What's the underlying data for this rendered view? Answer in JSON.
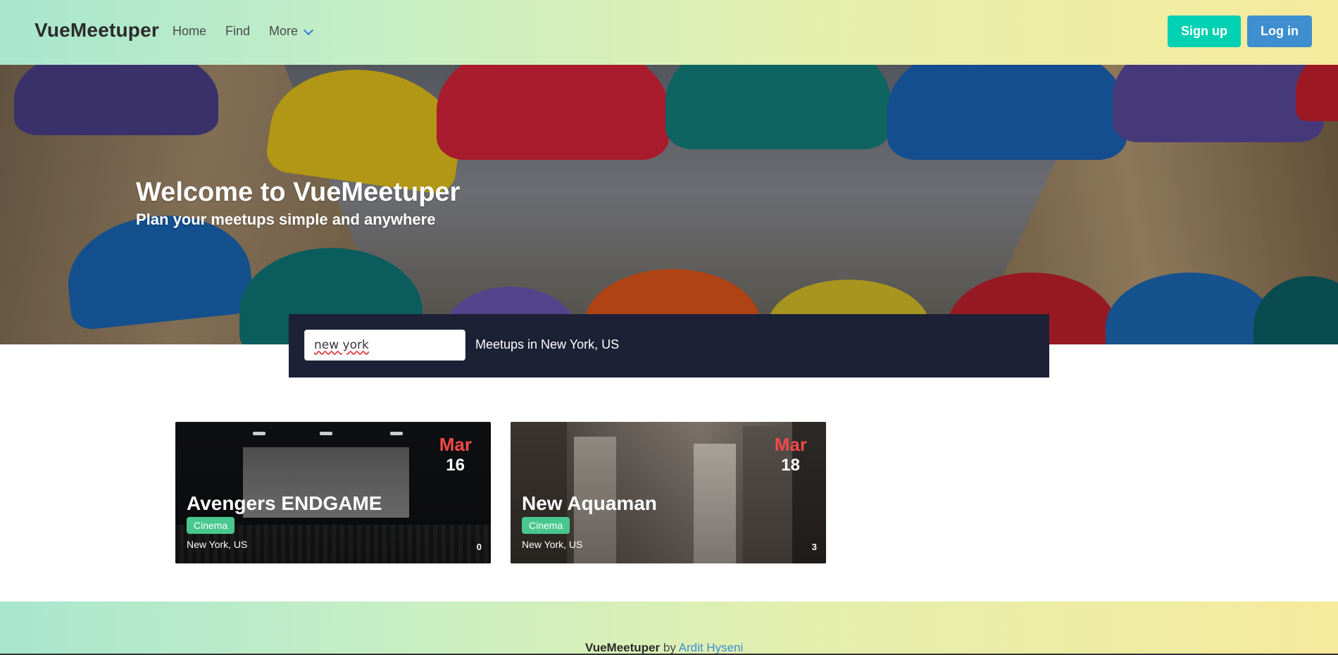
{
  "navbar": {
    "brand": "VueMeetuper",
    "items": [
      {
        "label": "Home"
      },
      {
        "label": "Find"
      },
      {
        "label": "More"
      }
    ],
    "signup_label": "Sign up",
    "login_label": "Log in"
  },
  "hero": {
    "title": "Welcome to VueMeetuper",
    "subtitle": "Plan your meetups simple and anywhere"
  },
  "search": {
    "value": "new york",
    "result_text": "Meetups in New York, US"
  },
  "meetups": [
    {
      "month": "Mar",
      "day": "16",
      "title": "Avengers ENDGAME",
      "category": "Cinema",
      "location": "New York, US",
      "count": "0"
    },
    {
      "month": "Mar",
      "day": "18",
      "title": "New Aquaman",
      "category": "Cinema",
      "location": "New York, US",
      "count": "3"
    }
  ],
  "footer": {
    "brand": "VueMeetuper",
    "by": "by",
    "author": "Ardit Hyseni"
  },
  "colors": {
    "primary": "#00d1b2",
    "info": "#3e8ed0",
    "success": "#48c78e",
    "date_month": "#f14a4a",
    "search_bg": "#1c2136"
  },
  "icons": {
    "more_dropdown": "chevron-down-icon"
  }
}
